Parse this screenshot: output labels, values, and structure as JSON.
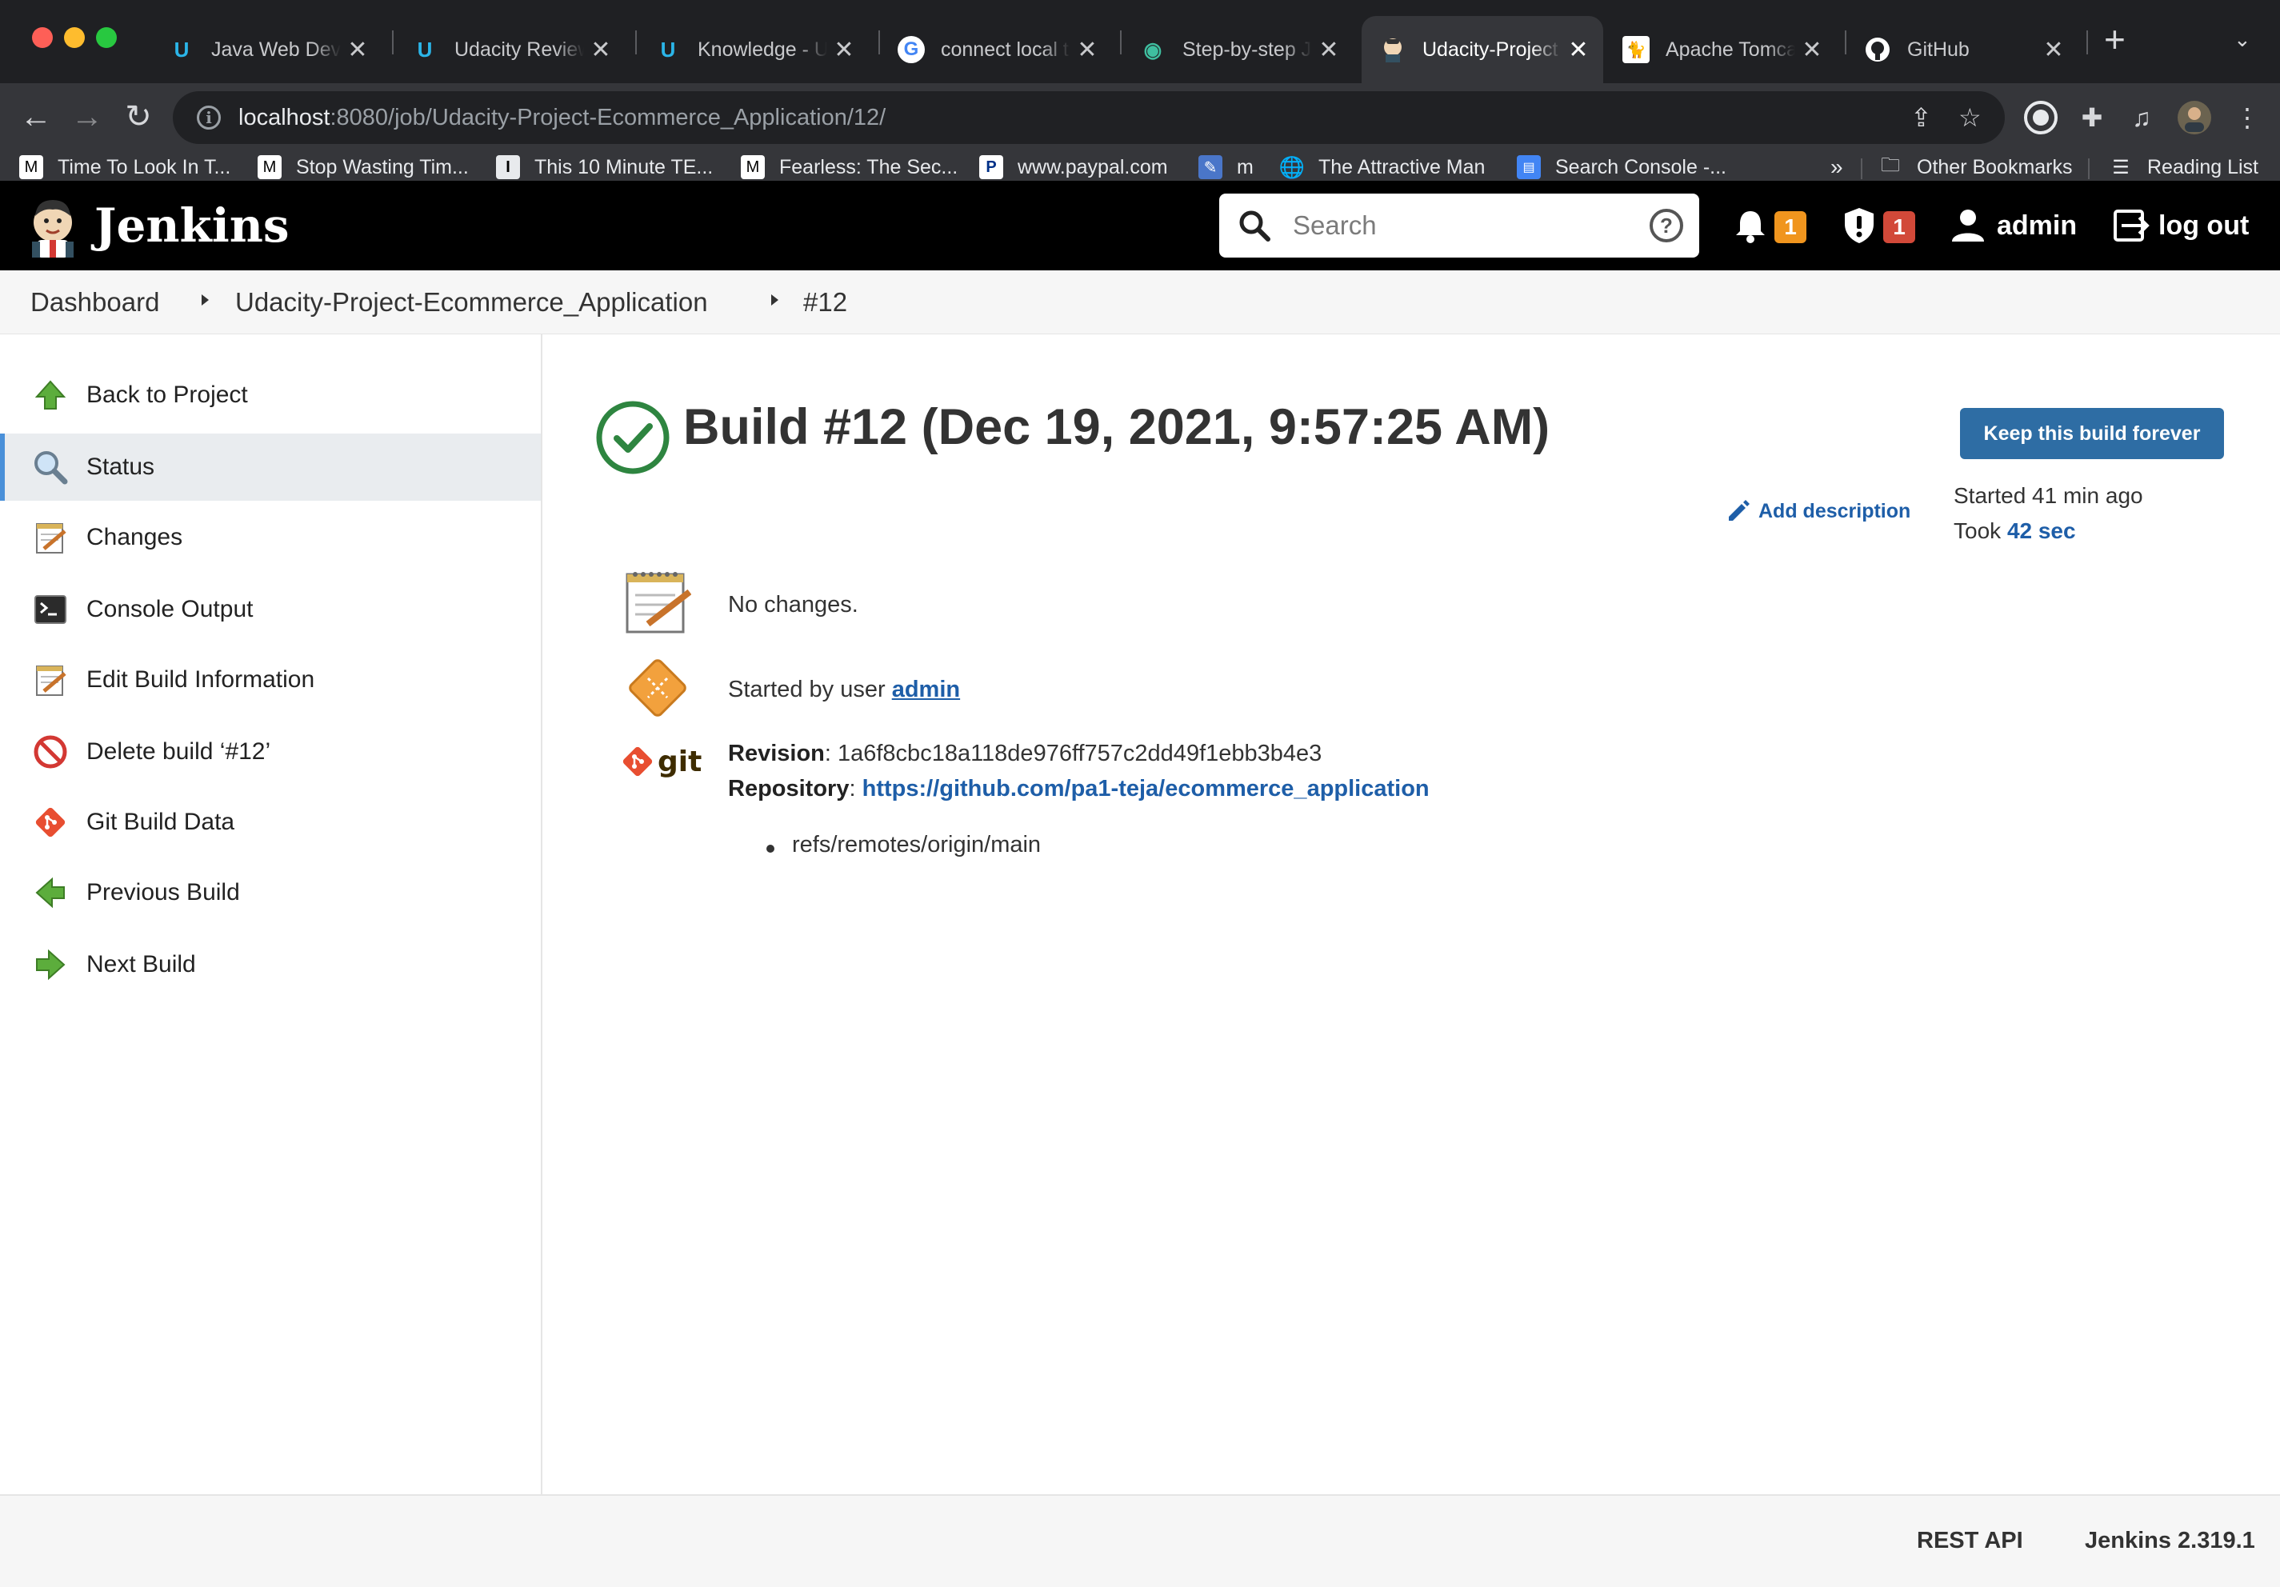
{
  "browser": {
    "tabs": [
      {
        "title": "Java Web Deve",
        "icon": "udacity-icon"
      },
      {
        "title": "Udacity Review",
        "icon": "udacity-icon"
      },
      {
        "title": "Knowledge - U",
        "icon": "udacity-icon"
      },
      {
        "title": "connect local t",
        "icon": "google-icon"
      },
      {
        "title": "Step-by-step J",
        "icon": "eye-icon"
      },
      {
        "title": "Udacity-Project",
        "icon": "jenkins-icon",
        "active": true
      },
      {
        "title": "Apache Tomcat",
        "icon": "tomcat-icon"
      },
      {
        "title": "GitHub",
        "icon": "github-icon"
      }
    ],
    "url_host": "localhost",
    "url_path": ":8080/job/Udacity-Project-Ecommerce_Application/12/",
    "bookmarks": [
      {
        "label": "Time To Look In T...",
        "icon": "medium-icon"
      },
      {
        "label": "Stop Wasting Tim...",
        "icon": "medium-icon"
      },
      {
        "label": "This 10 Minute TE...",
        "icon": "ted-icon"
      },
      {
        "label": "Fearless: The Sec...",
        "icon": "medium-icon"
      },
      {
        "label": "www.paypal.com",
        "icon": "paypal-icon"
      },
      {
        "label": "m",
        "icon": "app-icon"
      },
      {
        "label": "The Attractive Man",
        "icon": "globe-icon"
      },
      {
        "label": "Search Console -...",
        "icon": "search-console-icon"
      }
    ],
    "more_bookmarks": "»",
    "other_bookmarks": "Other Bookmarks",
    "reading_list": "Reading List"
  },
  "header": {
    "title": "Jenkins",
    "search_placeholder": "Search",
    "notifications_count": "1",
    "security_count": "1",
    "user": "admin",
    "logout": "log out",
    "colors": {
      "notification_badge": "#f0951e",
      "security_badge": "#d24939"
    }
  },
  "breadcrumb": {
    "items": [
      "Dashboard",
      "Udacity-Project-Ecommerce_Application",
      "#12"
    ]
  },
  "sidepanel": {
    "items": [
      {
        "label": "Back to Project",
        "icon": "up-arrow-icon"
      },
      {
        "label": "Status",
        "icon": "magnifier-icon",
        "active": true
      },
      {
        "label": "Changes",
        "icon": "notepad-icon"
      },
      {
        "label": "Console Output",
        "icon": "terminal-icon"
      },
      {
        "label": "Edit Build Information",
        "icon": "notepad-icon"
      },
      {
        "label": "Delete build ‘#12’",
        "icon": "no-entry-icon"
      },
      {
        "label": "Git Build Data",
        "icon": "git-icon"
      },
      {
        "label": "Previous Build",
        "icon": "left-arrow-icon"
      },
      {
        "label": "Next Build",
        "icon": "right-arrow-icon"
      }
    ]
  },
  "build": {
    "title": "Build #12 (Dec 19, 2021, 9:57:25 AM)",
    "keep_button": "Keep this build forever",
    "add_description": "Add description",
    "started": "Started 41 min ago",
    "took_label": "Took",
    "took_value": "42 sec",
    "changes_text": "No changes.",
    "started_by_prefix": "Started by user",
    "started_by_user": "admin",
    "revision_label": "Revision",
    "revision_value": ": 1a6f8cbc18a118de976ff757c2dd49f1ebb3b4e3",
    "repository_label": "Repository",
    "repository_sep": ":",
    "repository_url": "https://github.com/pa1-teja/ecommerce_application",
    "branch": "refs/remotes/origin/main",
    "git_logo_text": "git",
    "status_color": "#2e8540"
  },
  "footer": {
    "rest_api": "REST API",
    "version": "Jenkins 2.319.1"
  }
}
